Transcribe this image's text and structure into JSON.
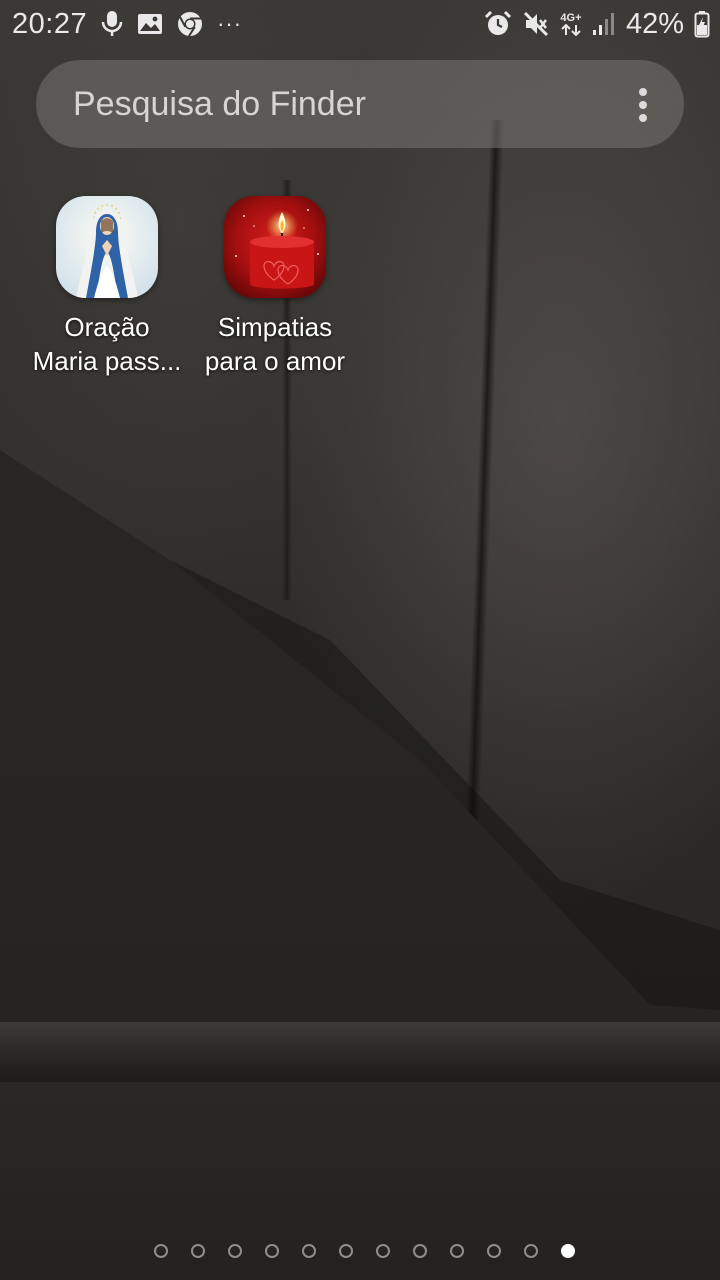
{
  "status_bar": {
    "time": "20:27",
    "left_icons": [
      "microphone-icon",
      "gallery-icon",
      "chrome-icon",
      "more-notifications-icon"
    ],
    "more_glyph": "···",
    "right_icons": [
      "alarm-icon",
      "mute-icon",
      "4g-data-icon",
      "signal-icon",
      "battery-charging-icon"
    ],
    "network_label": "4G+",
    "battery_percent": "42%"
  },
  "search": {
    "placeholder": "Pesquisa do Finder",
    "menu_icon": "more-vertical-icon"
  },
  "apps": [
    {
      "id": "oracao",
      "label_line1": "Oração",
      "label_line2": "Maria pass...",
      "icon": "virgin-mary-icon"
    },
    {
      "id": "simpatias",
      "label_line1": "Simpatias",
      "label_line2": "para o amor",
      "icon": "red-candle-icon"
    }
  ],
  "pager": {
    "page_count": 12,
    "current_page": 12
  },
  "colors": {
    "status_text": "#e9e9e9",
    "search_bg": "#76746f",
    "search_text": "#d6d5d2",
    "label_text": "#ffffff"
  }
}
